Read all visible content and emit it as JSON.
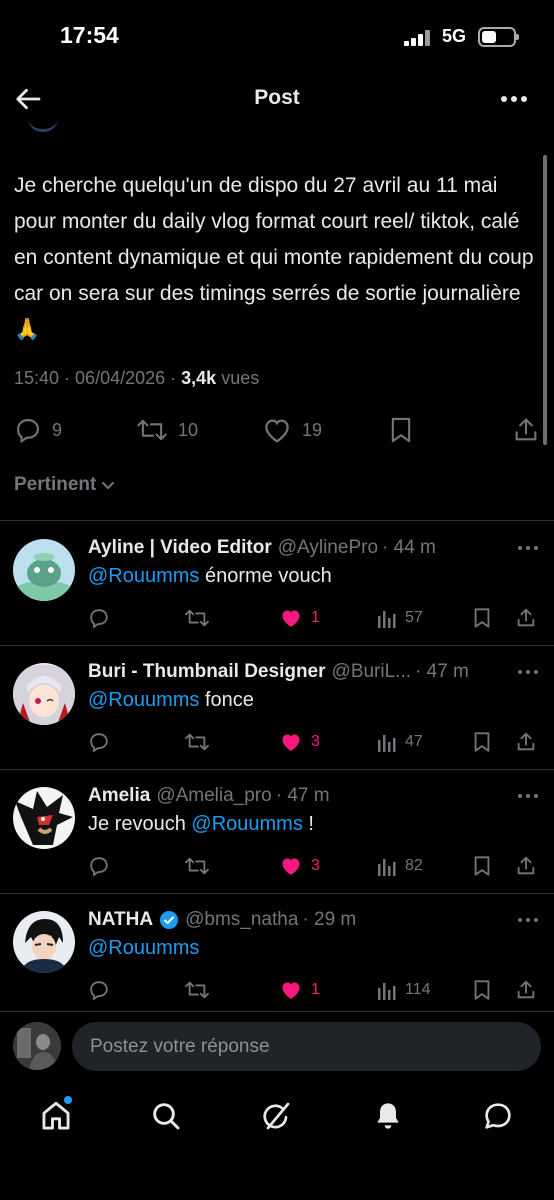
{
  "status_bar": {
    "time": "17:54",
    "network": "5G"
  },
  "header": {
    "title": "Post"
  },
  "post": {
    "text": "Je cherche quelqu'un de dispo du 27 avril au 11 mai pour monter du daily vlog format court reel/ tiktok, calé en content dynamique et qui monte rapidement du coup car on sera sur des timings serrés de sortie journalière  🙏",
    "time": "15:40",
    "date": "06/04/2026",
    "views_count": "3,4k",
    "views_label": "vues",
    "replies": "9",
    "reposts": "10",
    "likes": "19"
  },
  "sort": {
    "label": "Pertinent"
  },
  "replies": [
    {
      "name": "Ayline | Video Editor",
      "handle": "@AylinePro",
      "time": "· 44 m",
      "mention": "@Rouumms",
      "text_after": " énorme vouch",
      "text_before": "",
      "likes": "1",
      "views": "57"
    },
    {
      "name": "Buri - Thumbnail Designer",
      "handle": "@BuriL...",
      "time": "· 47 m",
      "mention": "@Rouumms",
      "text_after": " fonce",
      "text_before": "",
      "likes": "3",
      "views": "47"
    },
    {
      "name": "Amelia",
      "handle": "@Amelia_pro",
      "time": "· 47 m",
      "mention": "@Rouumms",
      "text_after": " !",
      "text_before": "Je revouch ",
      "likes": "3",
      "views": "82"
    },
    {
      "name": "NATHA",
      "handle": "@bms_natha",
      "time": "· 29 m",
      "mention": "@Rouumms",
      "text_after": "",
      "text_before": "",
      "likes": "1",
      "views": "114"
    }
  ],
  "composer": {
    "placeholder": "Postez votre réponse"
  },
  "colors": {
    "accent": "#1d9bf0",
    "like": "#f91880",
    "muted": "#71767b",
    "background": "#000000"
  },
  "nav": [
    "home-icon",
    "search-icon",
    "grok-icon",
    "notifications-icon",
    "messages-icon"
  ]
}
